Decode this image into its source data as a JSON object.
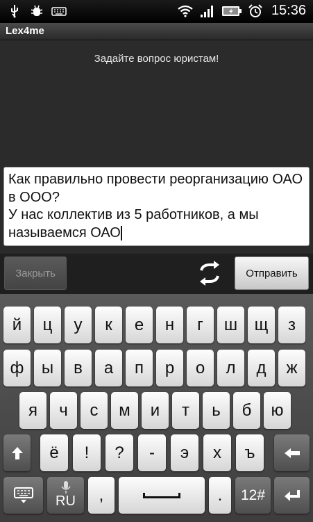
{
  "status_bar": {
    "left_icons": [
      "usb-icon",
      "debug-icon",
      "keyboard-icon"
    ],
    "right_icons": [
      "wifi-icon",
      "signal-icon",
      "battery-icon",
      "alarm-icon"
    ],
    "time": "15:36"
  },
  "app": {
    "title": "Lex4me"
  },
  "main": {
    "prompt": "Задайте вопрос юристам!",
    "question": "Как правильно провести реорганизацию ОАО в ООО?\nУ нас коллектив из 5 работников, а мы называемся ОАО"
  },
  "actions": {
    "close_label": "Закрыть",
    "swap_icon": "swap-icon",
    "send_label": "Отправить"
  },
  "keyboard": {
    "row1": [
      "й",
      "ц",
      "у",
      "к",
      "е",
      "н",
      "г",
      "ш",
      "щ",
      "з"
    ],
    "row2": [
      "ф",
      "ы",
      "в",
      "а",
      "п",
      "р",
      "о",
      "л",
      "д",
      "ж"
    ],
    "row3": [
      "я",
      "ч",
      "с",
      "м",
      "и",
      "т",
      "ь",
      "б",
      "ю"
    ],
    "row4": [
      "ё",
      "!",
      "?",
      "-",
      "э",
      "х",
      "ъ"
    ],
    "lang_label": "RU",
    "comma": ",",
    "period": ".",
    "numbers_label": "12#",
    "shift_icon": "shift-icon",
    "backspace_icon": "backspace-icon",
    "hide_keyboard_icon": "hide-keyboard-icon",
    "mic_icon": "mic-icon",
    "space_icon": "space-icon",
    "enter_icon": "enter-icon"
  }
}
